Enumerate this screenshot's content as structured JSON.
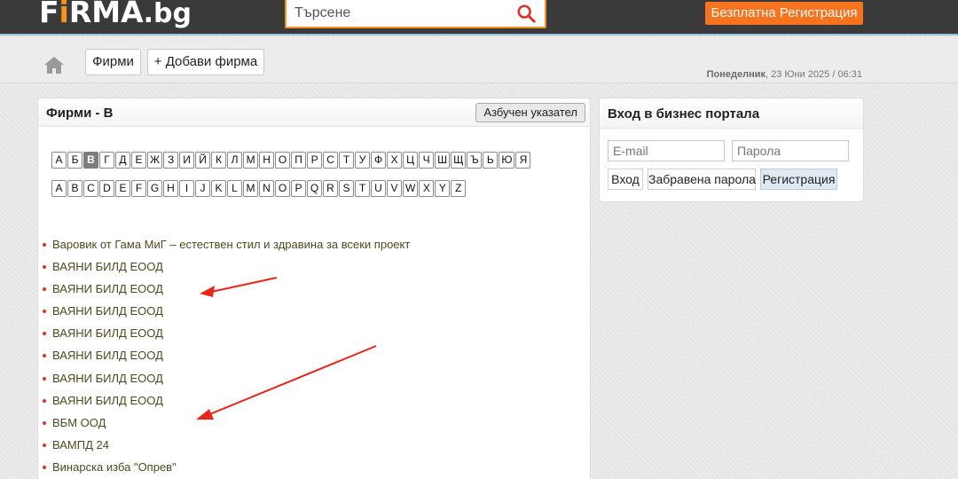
{
  "header": {
    "logo_prefix": "F",
    "logo_i": "i",
    "logo_main": "RMA",
    "logo_suffix": ".bg",
    "search_placeholder": "Търсене",
    "register_label": "Безплатна Регистрация"
  },
  "nav": {
    "firms_label": "Фирми",
    "add_firm_label": "+ Добави фирма",
    "date_day": "Понеделник",
    "date_rest": ", 23 Юни 2025 / 06:31"
  },
  "main": {
    "title": "Фирми - В",
    "alpha_index_label": "Азбучен указател",
    "cyrillic_letters": [
      "А",
      "Б",
      "В",
      "Г",
      "Д",
      "Е",
      "Ж",
      "З",
      "И",
      "Й",
      "К",
      "Л",
      "М",
      "Н",
      "О",
      "П",
      "Р",
      "С",
      "Т",
      "У",
      "Ф",
      "Х",
      "Ц",
      "Ч",
      "Ш",
      "Щ",
      "Ъ",
      "Ь",
      "Ю",
      "Я"
    ],
    "active_letter": "В",
    "latin_letters": [
      "A",
      "B",
      "C",
      "D",
      "E",
      "F",
      "G",
      "H",
      "I",
      "J",
      "K",
      "L",
      "M",
      "N",
      "O",
      "P",
      "Q",
      "R",
      "S",
      "T",
      "U",
      "V",
      "W",
      "X",
      "Y",
      "Z"
    ],
    "companies": [
      "Варовик от Гама МиГ – естествен стил и здравина за всеки проект",
      "ВАЯНИ БИЛД ЕООД",
      "ВАЯНИ БИЛД ЕООД",
      "ВАЯНИ БИЛД ЕООД",
      "ВАЯНИ БИЛД ЕООД",
      "ВАЯНИ БИЛД ЕООД",
      "ВАЯНИ БИЛД ЕООД",
      "ВАЯНИ БИЛД ЕООД",
      "ВБМ ООД",
      "ВАМПД 24",
      "Винарска изба \"Опрев\""
    ]
  },
  "login": {
    "title": "Вход в бизнес портала",
    "email_placeholder": "E-mail",
    "password_placeholder": "Парола",
    "login_label": "Вход",
    "forgot_label": "Забравена парола",
    "register_label": "Регистрация"
  },
  "colors": {
    "accent_orange": "#f7731e",
    "header_dark": "#3a3a3a",
    "bullet_red": "#d9342b",
    "arrow_red": "#e8261c"
  }
}
